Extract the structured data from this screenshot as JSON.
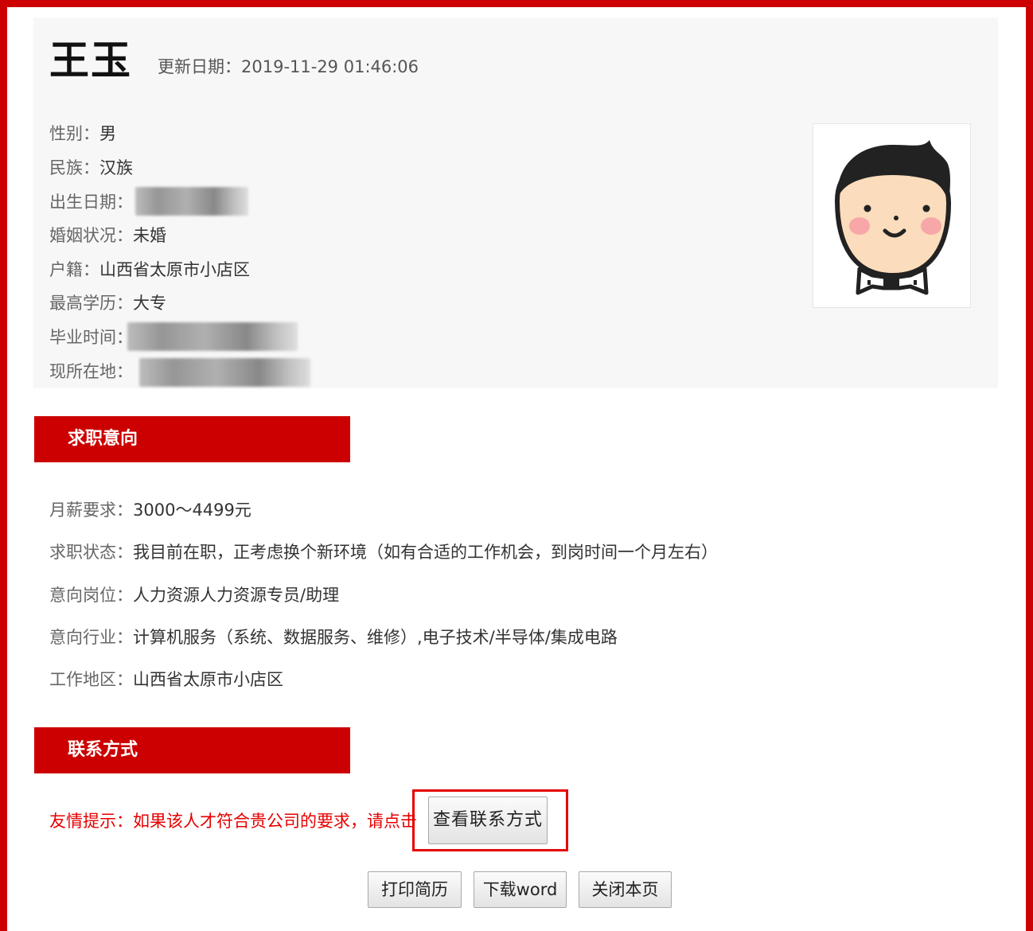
{
  "profile": {
    "name": "王玉",
    "update_label": "更新日期：",
    "update_value": "2019-11-29 01:46:06",
    "fields": [
      {
        "label": "性别：",
        "value": "男"
      },
      {
        "label": "民族：",
        "value": "汉族"
      },
      {
        "label": "出生日期：",
        "value": ""
      },
      {
        "label": "婚姻状况：",
        "value": "未婚"
      },
      {
        "label": "户籍：",
        "value": "山西省太原市小店区"
      },
      {
        "label": "最高学历：",
        "value": "大专"
      },
      {
        "label": "毕业时间：",
        "value": ""
      },
      {
        "label": "现所在地：",
        "value": ""
      }
    ]
  },
  "avatar_icon": "cartoon-avatar-icon",
  "job_intent": {
    "header": "求职意向",
    "rows": [
      {
        "label": "月薪要求：",
        "value": "3000～4499元"
      },
      {
        "label": "求职状态：",
        "value": "我目前在职，正考虑换个新环境（如有合适的工作机会，到岗时间一个月左右）"
      },
      {
        "label": "意向岗位：",
        "value": "人力资源人力资源专员/助理"
      },
      {
        "label": "意向行业：",
        "value": "计算机服务（系统、数据服务、维修）,电子技术/半导体/集成电路"
      },
      {
        "label": "工作地区：",
        "value": "山西省太原市小店区"
      }
    ]
  },
  "contact": {
    "header": "联系方式",
    "tip": "友情提示：如果该人才符合贵公司的要求，请点击",
    "view_button": "查看联系方式"
  },
  "actions": {
    "print": "打印简历",
    "download": "下载word",
    "close": "关闭本页"
  },
  "colors": {
    "accent": "#cc0000",
    "tip": "#e60000"
  }
}
